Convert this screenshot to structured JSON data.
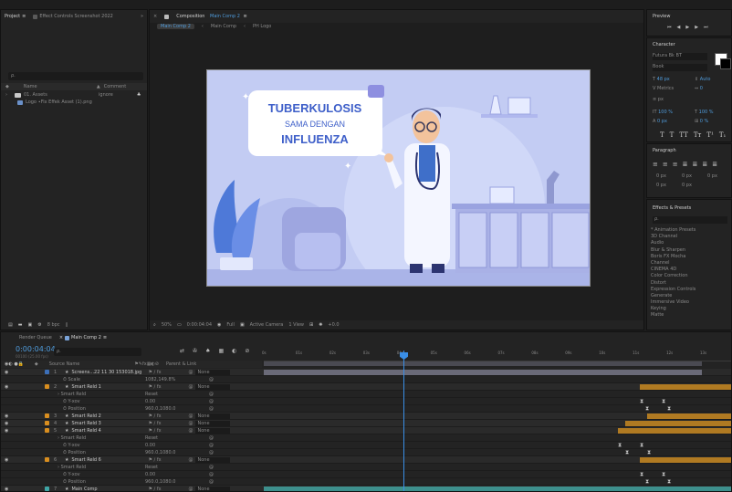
{
  "project_panel": {
    "tab_project": "Project",
    "tab_effect_controls": "Effect Controls Screenshot 2022",
    "search_placeholder": "ρ.",
    "col_name": "Name",
    "col_comment": "Comment",
    "items": [
      {
        "name": "01. Assets",
        "comment": "ignore"
      },
      {
        "name": "Logo ∙Fix Effek Asset (1).png",
        "comment": ""
      }
    ],
    "footer_bpc": "8 bpc"
  },
  "composition": {
    "tab_label": "Composition",
    "comp_name": "Main Comp 2",
    "breadcrumbs": [
      "Main Comp 2",
      "Main Comp",
      "PH Logo"
    ],
    "zoom": "50%",
    "timecode": "0:00:04:04",
    "resolution": "Full",
    "camera": "Active Camera",
    "view": "1 View",
    "exposure": "+0.0"
  },
  "illustration": {
    "line1": "TUBERKULOSIS",
    "line2": "SAMA DENGAN",
    "line3": "INFLUENZA"
  },
  "right_panel": {
    "preview_title": "Preview",
    "character_title": "Character",
    "font_name": "Futura Bk BT",
    "font_style": "Book",
    "font_size": "48 px",
    "leading": "Auto",
    "tracking": "0",
    "kerning": "Metrics",
    "stroke": "px",
    "vert_scale": "100 %",
    "horiz_scale": "100 %",
    "baseline": "0 px",
    "tsume": "0 %",
    "paragraph_title": "Paragraph",
    "para_values": [
      "0 px",
      "0 px",
      "0 px",
      "0 px",
      "0 px"
    ],
    "effects_title": "Effects & Presets",
    "effects_search": "ρ.",
    "effects_list": [
      "* Animation Presets",
      "3D Channel",
      "Audio",
      "Blur & Sharpen",
      "Boris FX Mocha",
      "Channel",
      "CINEMA 4D",
      "Color Correction",
      "Distort",
      "Expression Controls",
      "Generate",
      "Immersive Video",
      "Keying",
      "Matte"
    ]
  },
  "timeline": {
    "tab_render_queue": "Render Queue",
    "tab_comp": "Main Comp 2",
    "timecode": "0:00:04:04",
    "frames": "00100 (25.00 fps)",
    "search_placeholder": "ρ.",
    "col_source": "Source Name",
    "col_switches": "fx",
    "col_parent": "Parent & Link",
    "ruler": [
      "0s",
      "01s",
      "02s",
      "03s",
      "04s",
      "05s",
      "06s",
      "07s",
      "08s",
      "09s",
      "10s",
      "11s",
      "12s",
      "13s"
    ],
    "layers": [
      {
        "type": "layer",
        "num": "1",
        "name": "Screens...22 11 30 153018.jpg",
        "parent": "None",
        "color": "#3c6fb8"
      },
      {
        "type": "prop",
        "name": "Scale",
        "value": "1082,149.8%"
      },
      {
        "type": "layer",
        "num": "2",
        "name": "Smart Reld 1",
        "parent": "None",
        "color": "#d98e1f"
      },
      {
        "type": "group",
        "name": "Smart Reld",
        "value": "Reset"
      },
      {
        "type": "prop",
        "name": "Y-xov",
        "value": "0.00"
      },
      {
        "type": "prop",
        "name": "Position",
        "value": "960.0,1080.0"
      },
      {
        "type": "layer",
        "num": "3",
        "name": "Smart Reld 2",
        "parent": "None",
        "color": "#d98e1f"
      },
      {
        "type": "layer",
        "num": "4",
        "name": "Smart Reld 3",
        "parent": "None",
        "color": "#d98e1f"
      },
      {
        "type": "layer",
        "num": "5",
        "name": "Smart Reld 4",
        "parent": "None",
        "color": "#d98e1f"
      },
      {
        "type": "group",
        "name": "Smart Reld",
        "value": "Reset"
      },
      {
        "type": "prop",
        "name": "Y-xov",
        "value": "0.00"
      },
      {
        "type": "prop",
        "name": "Position",
        "value": "960.0,1080.0"
      },
      {
        "type": "layer",
        "num": "6",
        "name": "Smart Reld 6",
        "parent": "None",
        "color": "#d98e1f"
      },
      {
        "type": "group",
        "name": "Smart Reld",
        "value": "Reset"
      },
      {
        "type": "prop",
        "name": "Y-xov",
        "value": "0.00"
      },
      {
        "type": "prop",
        "name": "Position",
        "value": "960.0,1080.0"
      },
      {
        "type": "layer",
        "num": "7",
        "name": "Main Comp",
        "parent": "None",
        "color": "#3fa6a6"
      }
    ]
  },
  "colors": {
    "accent_blue": "#4f9bdb",
    "playhead": "#3a8ee6",
    "clip_orange": "#b07a22",
    "clip_gray": "#6a6a78",
    "clip_teal": "#3d8f8c",
    "illus_bg": "#c3ccf3"
  }
}
